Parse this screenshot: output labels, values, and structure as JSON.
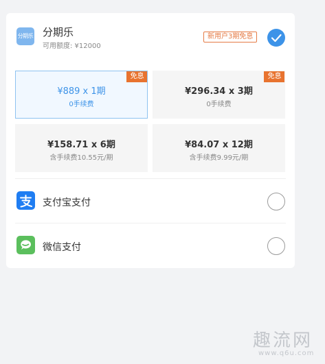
{
  "fenqile": {
    "logo_text": "分期乐",
    "name": "分期乐",
    "quota": "可用额度: ¥12000",
    "promo_badge": "新用户3期免息",
    "selected": true
  },
  "plans": [
    {
      "title": "¥889 x 1期",
      "subtitle": "0手续费",
      "tag": "免息",
      "selected": true
    },
    {
      "title": "¥296.34 x 3期",
      "subtitle": "0手续费",
      "tag": "免息",
      "selected": false
    },
    {
      "title": "¥158.71 x 6期",
      "subtitle": "含手续费10.55元/期",
      "tag": "",
      "selected": false
    },
    {
      "title": "¥84.07 x 12期",
      "subtitle": "含手续费9.99元/期",
      "tag": "",
      "selected": false
    }
  ],
  "payment_methods": [
    {
      "label": "支付宝支付",
      "icon": "alipay-icon",
      "color": "#1f7df2",
      "selected": false
    },
    {
      "label": "微信支付",
      "icon": "wechat-icon",
      "color": "#5bbf5d",
      "selected": false
    }
  ],
  "watermark": {
    "text": "趣流网",
    "url": "www.q6u.com"
  },
  "colors": {
    "accent": "#3d93e8",
    "promo": "#e8732f"
  }
}
